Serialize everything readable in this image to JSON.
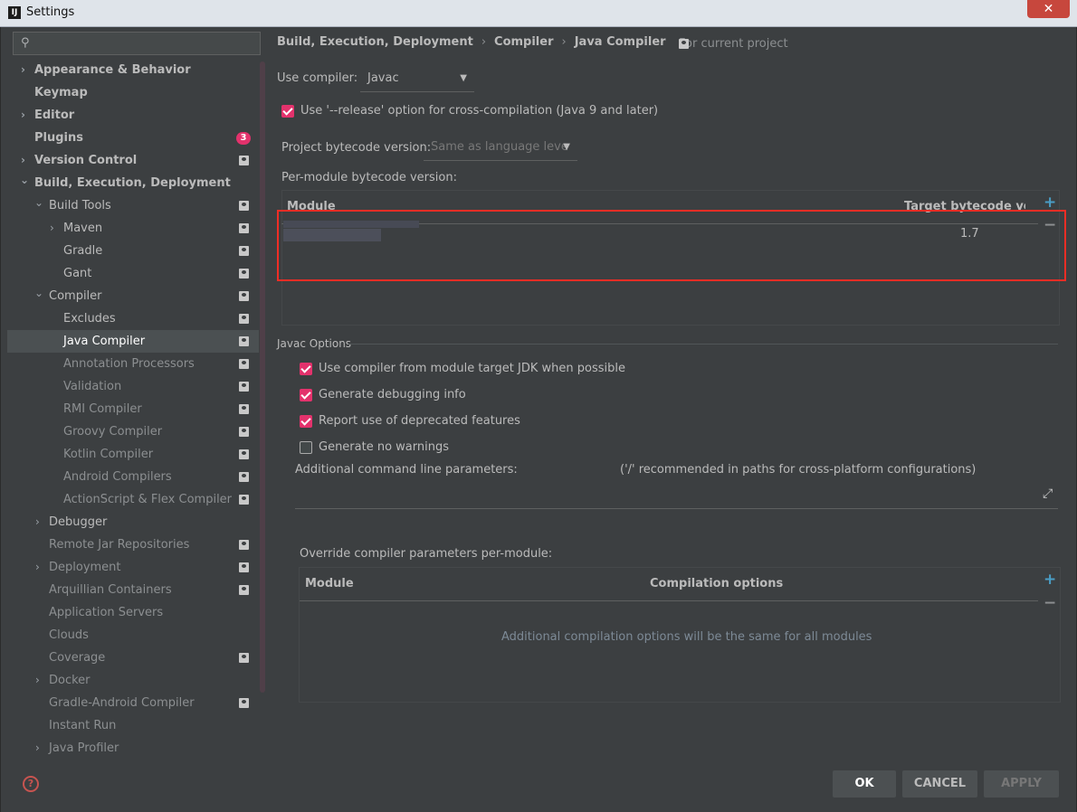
{
  "window": {
    "title": "Settings",
    "app_icon": "IJ",
    "close_glyph": "✕"
  },
  "sidebar": {
    "search_glyph": "⚲",
    "items": [
      {
        "label": "Appearance & Behavior"
      },
      {
        "label": "Keymap"
      },
      {
        "label": "Editor"
      },
      {
        "label": "Plugins",
        "badge": "3"
      },
      {
        "label": "Version Control"
      },
      {
        "label": "Build, Execution, Deployment"
      },
      {
        "label": "Build Tools"
      },
      {
        "label": "Maven"
      },
      {
        "label": "Gradle"
      },
      {
        "label": "Gant"
      },
      {
        "label": "Compiler"
      },
      {
        "label": "Excludes"
      },
      {
        "label": "Java Compiler"
      },
      {
        "label": "Annotation Processors"
      },
      {
        "label": "Validation"
      },
      {
        "label": "RMI Compiler"
      },
      {
        "label": "Groovy Compiler"
      },
      {
        "label": "Kotlin Compiler"
      },
      {
        "label": "Android Compilers"
      },
      {
        "label": "ActionScript & Flex Compiler"
      },
      {
        "label": "Debugger"
      },
      {
        "label": "Remote Jar Repositories"
      },
      {
        "label": "Deployment"
      },
      {
        "label": "Arquillian Containers"
      },
      {
        "label": "Application Servers"
      },
      {
        "label": "Clouds"
      },
      {
        "label": "Coverage"
      },
      {
        "label": "Docker"
      },
      {
        "label": "Gradle-Android Compiler"
      },
      {
        "label": "Instant Run"
      },
      {
        "label": "Java Profiler"
      }
    ],
    "chevron_right": "›",
    "chevron_down": "⌄",
    "help_glyph": "?"
  },
  "panel": {
    "breadcrumb": [
      "Build, Execution, Deployment",
      "Compiler",
      "Java Compiler"
    ],
    "breadcrumb_sep": "›",
    "scope_label": "For current project",
    "use_compiler_label": "Use compiler:",
    "use_compiler_value": "Javac",
    "release_option_label": "Use '--release' option for cross-compilation (Java 9 and later)",
    "bytecode_label": "Project bytecode version:",
    "bytecode_value": "Same as language leve",
    "per_module_label": "Per-module bytecode version:",
    "module_table": {
      "col_module": "Module",
      "col_target": "Target bytecode versi",
      "rows": [
        {
          "module": "",
          "target": "1.7"
        }
      ]
    },
    "javac_section": "Javac Options",
    "options": [
      {
        "label": "Use compiler from module target JDK when possible",
        "checked": true
      },
      {
        "label": "Generate debugging info",
        "checked": true
      },
      {
        "label": "Report use of deprecated features",
        "checked": true
      },
      {
        "label": "Generate no warnings",
        "checked": false
      }
    ],
    "cmd_params_label": "Additional command line parameters:",
    "cmd_params_hint": "('/' recommended in paths for cross-platform configurations)",
    "expand_glyph": "⤢",
    "override_label": "Override compiler parameters per-module:",
    "override_table": {
      "col_module": "Module",
      "col_options": "Compilation options",
      "empty": "Additional compilation options will be the same for all modules"
    },
    "plus_glyph": "+",
    "minus_glyph": "−"
  },
  "buttons": {
    "ok": "OK",
    "cancel": "CANCEL",
    "apply": "APPLY"
  },
  "colors": {
    "accent_pink": "#e3326c",
    "highlight_red": "#ef2d25",
    "add_blue": "#4a9ec6"
  }
}
